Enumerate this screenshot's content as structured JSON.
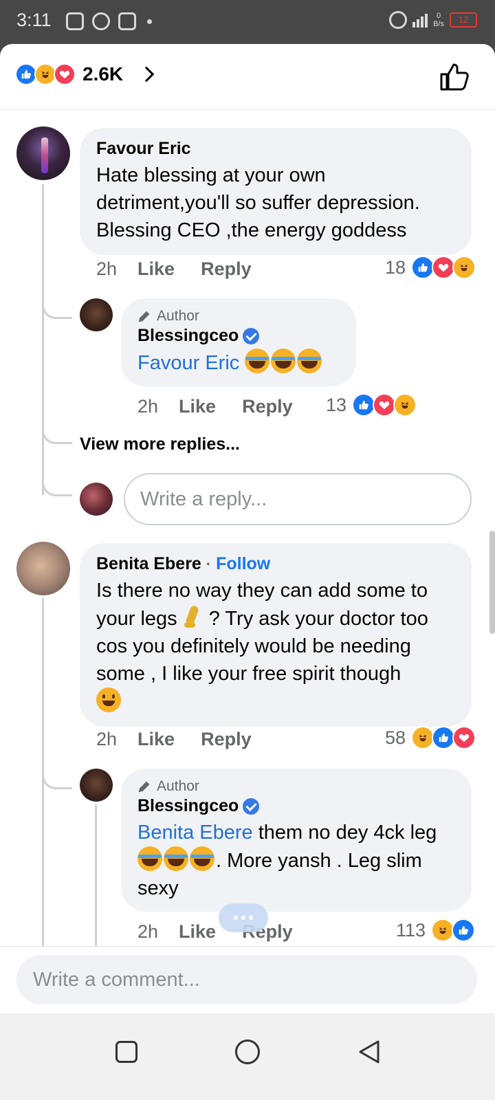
{
  "status_bar": {
    "time": "3:11",
    "net_speed": "0",
    "net_unit": "B/s",
    "battery": "12"
  },
  "header": {
    "reaction_count": "2.6K",
    "reactions": [
      "like",
      "haha",
      "love"
    ]
  },
  "comments": [
    {
      "name": "Favour Eric",
      "text": "Hate blessing at your own detriment,you'll so suffer depression. Blessing CEO ,the energy goddess",
      "time": "2h",
      "like_label": "Like",
      "reply_label": "Reply",
      "reaction_count": "18",
      "reactions": [
        "like",
        "love",
        "haha"
      ],
      "reply": {
        "badge": "Author",
        "name": "Blessingceo",
        "mention": "Favour Eric",
        "text": "",
        "emojis": [
          "joy",
          "joy",
          "joy"
        ],
        "time": "2h",
        "like_label": "Like",
        "reply_label": "Reply",
        "reaction_count": "13",
        "reactions": [
          "like",
          "love",
          "haha"
        ]
      },
      "view_more": "View more replies...",
      "reply_placeholder": "Write a reply..."
    },
    {
      "name": "Benita Ebere",
      "follow_label": "Follow",
      "text_part1": "Is there no way they can add some to your legs",
      "text_part2": "? Try ask your doctor too cos you definitely would be needing some , I like your free spirit though",
      "time": "2h",
      "like_label": "Like",
      "reply_label": "Reply",
      "reaction_count": "58",
      "reactions": [
        "haha",
        "like",
        "love"
      ],
      "reply": {
        "badge": "Author",
        "name": "Blessingceo",
        "mention": "Benita Ebere",
        "text_part1": " them no dey 4ck leg",
        "text_part2": ". More yansh . Leg slim sexy",
        "time": "2h",
        "like_label": "Like",
        "reply_label": "Reply",
        "reaction_count": "113",
        "reactions": [
          "haha",
          "like"
        ]
      }
    }
  ],
  "footer": {
    "comment_placeholder": "Write a comment..."
  }
}
